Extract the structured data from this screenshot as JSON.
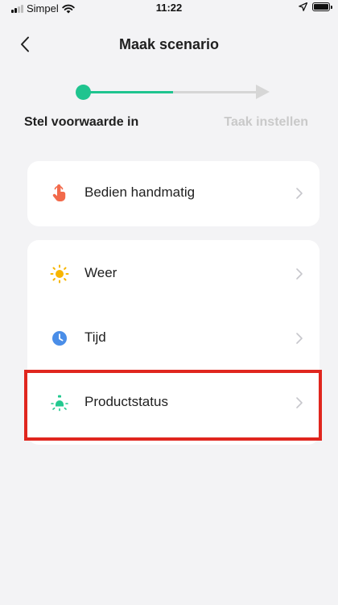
{
  "status_bar": {
    "carrier": "Simpel",
    "time": "11:22"
  },
  "header": {
    "title": "Maak scenario"
  },
  "stepper": {
    "step_1_label": "Stel voorwaarde in",
    "step_2_label": "Taak instellen",
    "active_color": "#1fc48f",
    "inactive_color": "#d6d6d6"
  },
  "cards": {
    "manual": {
      "label": "Bedien handmatig",
      "icon": "hand-tap-icon",
      "icon_color": "#f26a4b"
    },
    "conditions": [
      {
        "label": "Weer",
        "icon": "sun-icon",
        "icon_color": "#f7b500"
      },
      {
        "label": "Tijd",
        "icon": "clock-icon",
        "icon_color": "#4a8ee8"
      },
      {
        "label": "Productstatus",
        "icon": "device-status-icon",
        "icon_color": "#22c98f"
      }
    ]
  },
  "highlight": {
    "target": "Productstatus",
    "color": "#e0261e"
  }
}
